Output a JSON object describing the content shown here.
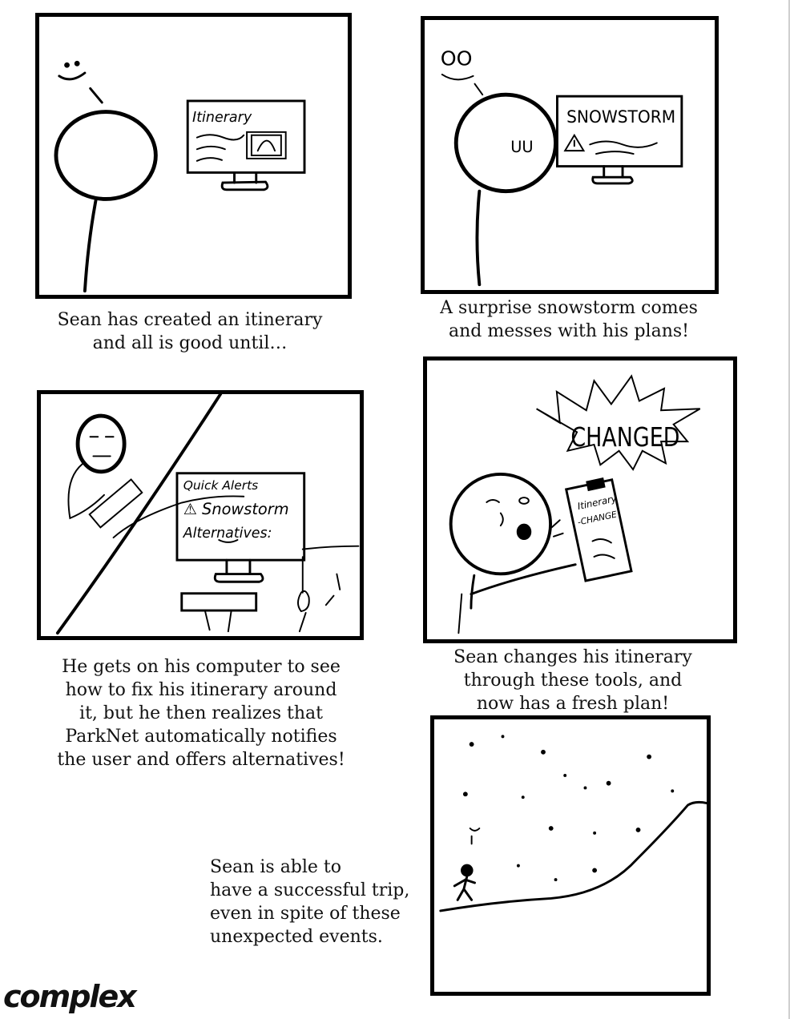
{
  "panels": [
    {
      "caption_lines": [
        "Sean has created an itinerary",
        "and all is good until…"
      ],
      "screen_text": [
        "Itinerary"
      ]
    },
    {
      "caption_lines": [
        "A surprise snowstorm comes",
        "and messes with his plans!"
      ],
      "screen_text": [
        "SNOWSTORM"
      ],
      "face_text": "OO",
      "cheek_text": "UU"
    },
    {
      "caption_lines": [
        "He gets on his computer to see",
        "how to fix his itinerary around",
        "it, but he then realizes that",
        "ParkNet automatically notifies",
        "the user and offers alternatives!"
      ],
      "screen_text": [
        "Quick Alerts",
        "⚠ Snowstorm",
        "Alternatives:"
      ]
    },
    {
      "caption_lines": [
        "Sean changes his itinerary",
        "through these tools, and",
        "now has a fresh plan!"
      ],
      "burst_text": "CHANGED",
      "phone_text": [
        "Itinerary",
        "-CHANGE"
      ]
    },
    {
      "caption_lines": [
        "Sean is able to",
        "have a successful trip,",
        "even in spite of these",
        "unexpected events."
      ]
    }
  ],
  "signature": "complex"
}
